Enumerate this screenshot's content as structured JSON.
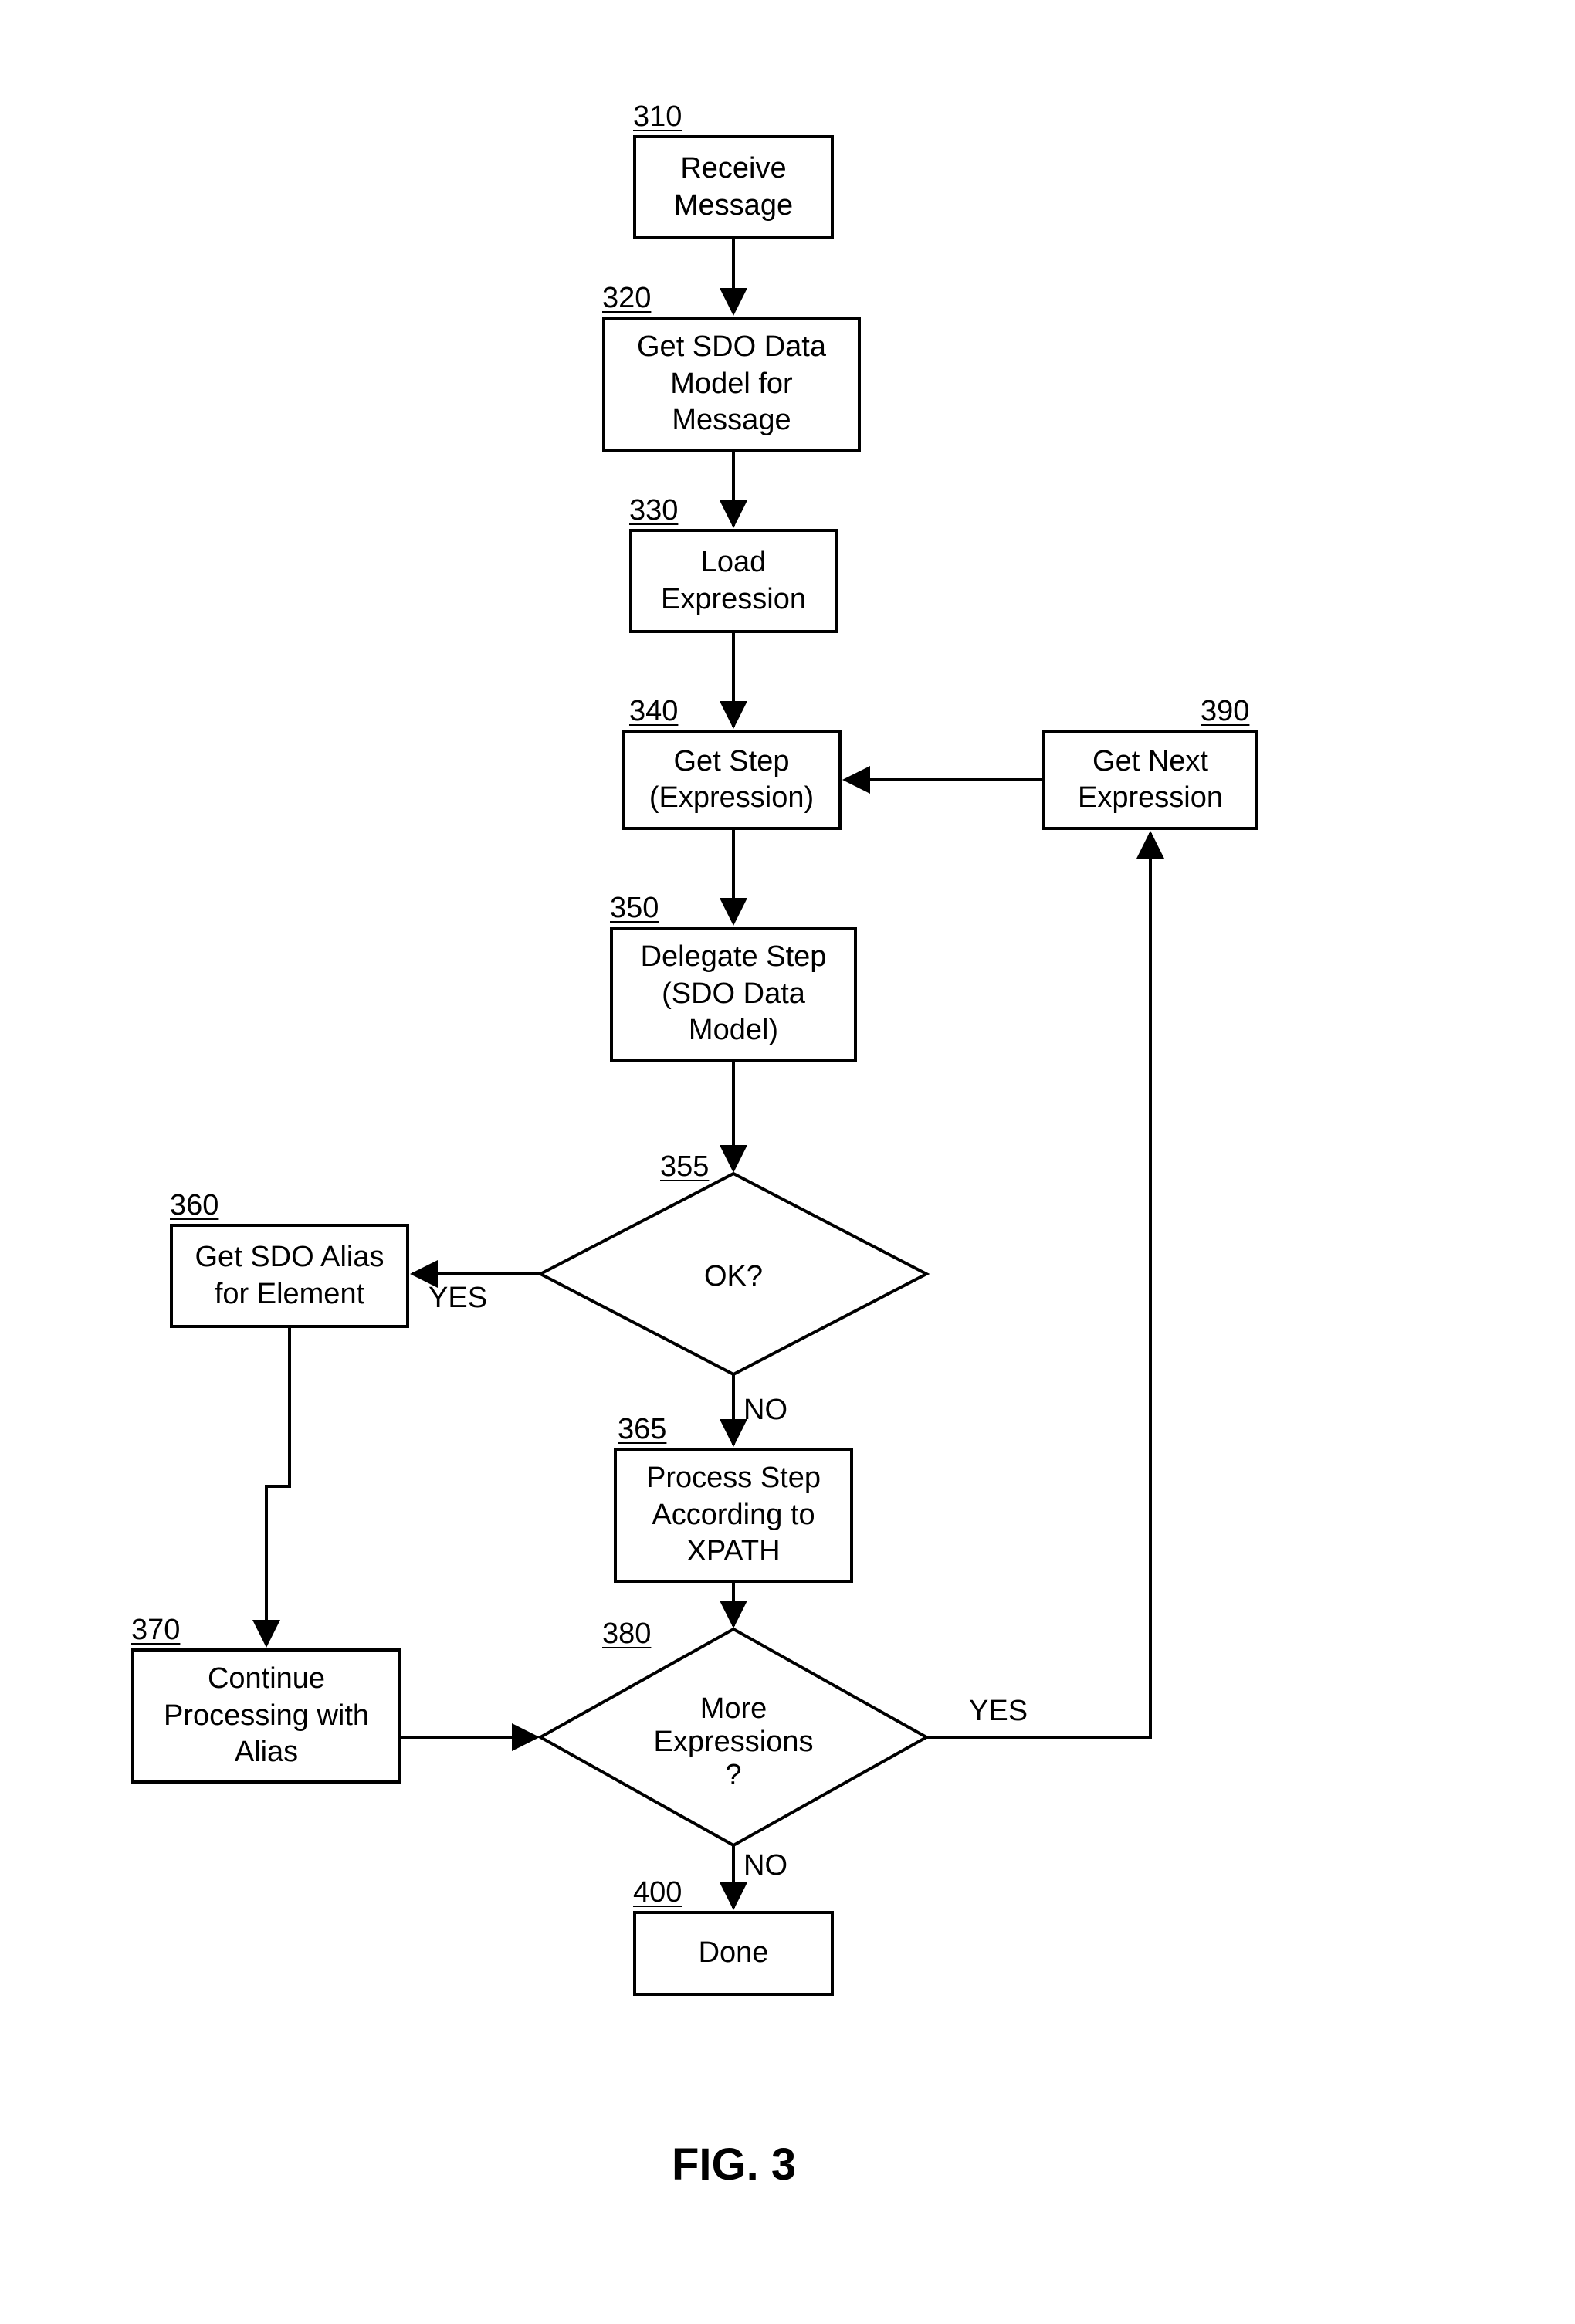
{
  "figure_caption": "FIG. 3",
  "nodes": {
    "n310": {
      "num": "310",
      "text": "Receive\nMessage"
    },
    "n320": {
      "num": "320",
      "text": "Get SDO Data\nModel for\nMessage"
    },
    "n330": {
      "num": "330",
      "text": "Load\nExpression"
    },
    "n340": {
      "num": "340",
      "text": "Get Step\n(Expression)"
    },
    "n350": {
      "num": "350",
      "text": "Delegate Step\n(SDO Data\nModel)"
    },
    "n355": {
      "num": "355",
      "text": "OK?"
    },
    "n360": {
      "num": "360",
      "text": "Get SDO Alias\nfor Element"
    },
    "n365": {
      "num": "365",
      "text": "Process Step\nAccording to\nXPATH"
    },
    "n370": {
      "num": "370",
      "text": "Continue\nProcessing with\nAlias"
    },
    "n380": {
      "num": "380",
      "text": "More\nExpressions\n?"
    },
    "n390": {
      "num": "390",
      "text": "Get Next\nExpression"
    },
    "n400": {
      "num": "400",
      "text": "Done"
    }
  },
  "edge_labels": {
    "e355_yes": "YES",
    "e355_no": "NO",
    "e380_yes": "YES",
    "e380_no": "NO"
  }
}
